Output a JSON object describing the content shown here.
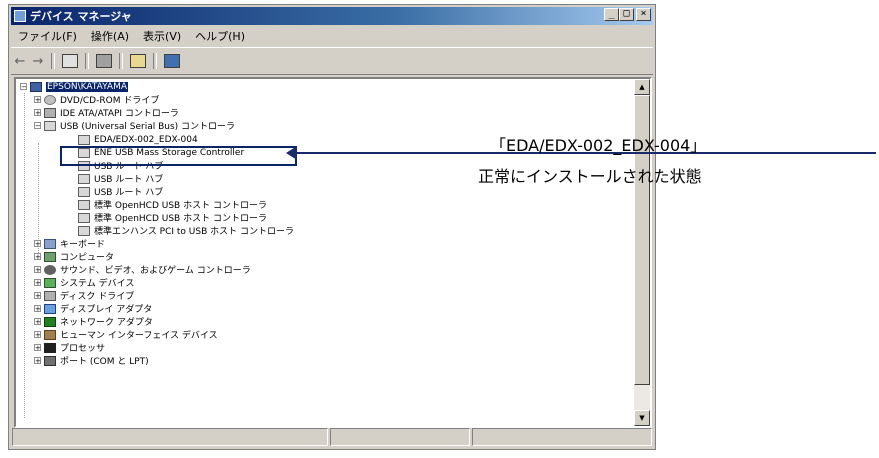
{
  "window": {
    "title": "デバイス マネージャ",
    "caption_buttons": [
      "_",
      "□",
      "×"
    ]
  },
  "menu": [
    "ファイル(F)",
    "操作(A)",
    "表示(V)",
    "ヘルプ(H)"
  ],
  "toolbar": {
    "back": "←",
    "forward": "→"
  },
  "tree": {
    "root": "EPSON\\KATAYAMA",
    "categories": [
      {
        "label": "DVD/CD-ROM ドライブ",
        "icon": "drive-icon"
      },
      {
        "label": "IDE ATA/ATAPI コントローラ",
        "icon": "ide-icon"
      },
      {
        "label": "USB (Universal Serial Bus) コントローラ",
        "icon": "usb-icon"
      }
    ],
    "usb_children": [
      "EDA/EDX-002_EDX-004",
      "ENE USB Mass Storage Controller",
      "USB ルート ハブ",
      "USB ルート ハブ",
      "USB ルート ハブ",
      "標準 OpenHCD USB ホスト コントローラ",
      "標準 OpenHCD USB ホスト コントローラ",
      "標準エンハンス PCI to USB ホスト コントローラ"
    ],
    "more_categories": [
      {
        "label": "キーボード",
        "icon": "keyboard-icon"
      },
      {
        "label": "コンピュータ",
        "icon": "computer-icon"
      },
      {
        "label": "サウンド、ビデオ、およびゲーム コントローラ",
        "icon": "sound-icon"
      },
      {
        "label": "システム デバイス",
        "icon": "system-icon"
      },
      {
        "label": "ディスク ドライブ",
        "icon": "disk-icon"
      },
      {
        "label": "ディスプレイ アダプタ",
        "icon": "display-icon"
      },
      {
        "label": "ネットワーク アダプタ",
        "icon": "network-icon"
      },
      {
        "label": "ヒューマン インターフェイス デバイス",
        "icon": "hid-icon"
      },
      {
        "label": "プロセッサ",
        "icon": "processor-icon"
      },
      {
        "label": "ポート (COM と LPT)",
        "icon": "port-icon"
      }
    ],
    "expand_plus": "+",
    "expand_minus": "−"
  },
  "annotation": {
    "line1": "「EDA/EDX-002_EDX-004」",
    "line2": "正常にインストールされた状態"
  },
  "colors": {
    "selection": "#0a246a",
    "annotation_line": "#1a2a6a",
    "window_face": "#d4d0c8"
  }
}
